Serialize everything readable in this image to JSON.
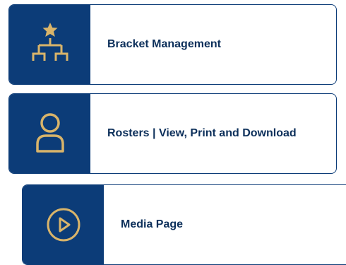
{
  "cards": [
    {
      "label": "Bracket Management",
      "icon": "bracket-tree-icon"
    },
    {
      "label": "Rosters | View, Print and Download",
      "icon": "person-icon"
    },
    {
      "label": "Media Page",
      "icon": "play-circle-icon"
    }
  ],
  "colors": {
    "navy": "#0c3c78",
    "gold": "#d9b46a",
    "text": "#0c2f5a"
  }
}
